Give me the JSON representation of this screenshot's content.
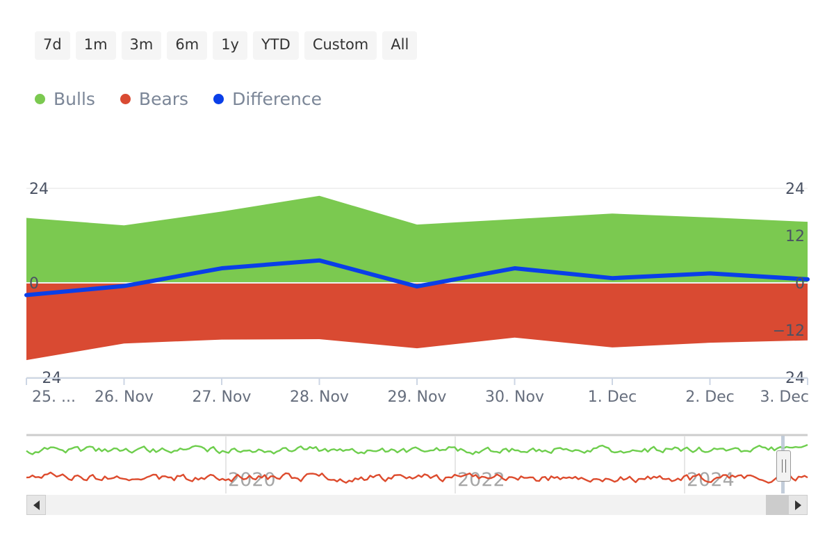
{
  "range_selector": {
    "buttons": [
      {
        "label": "7d",
        "name": "range-7d"
      },
      {
        "label": "1m",
        "name": "range-1m"
      },
      {
        "label": "3m",
        "name": "range-3m"
      },
      {
        "label": "6m",
        "name": "range-6m"
      },
      {
        "label": "1y",
        "name": "range-1y"
      },
      {
        "label": "YTD",
        "name": "range-ytd"
      },
      {
        "label": "Custom",
        "name": "range-custom"
      },
      {
        "label": "All",
        "name": "range-all"
      }
    ]
  },
  "legend": {
    "items": [
      {
        "label": "Bulls",
        "color": "#7BC950"
      },
      {
        "label": "Bears",
        "color": "#D94A32"
      },
      {
        "label": "Difference",
        "color": "#0A3FE8"
      }
    ]
  },
  "colors": {
    "bulls": "#7BC950",
    "bears": "#D94A32",
    "difference": "#0A3FE8",
    "grid": "#f0f0f0",
    "axis_line": "#cdd6e4",
    "tick": "#cdd6e4",
    "label": "#4a5263",
    "xlabel": "#666e7d",
    "legend_text": "#7b8697",
    "nav_year": "#a6a6a6",
    "nav_green": "#6ece4d",
    "nav_red": "#dd4b2d",
    "scrollbar_track": "#f2f2f2",
    "scrollbar_thumb": "#cccccc",
    "scrollbar_button": "#e6e6e6",
    "button_bg": "#f5f5f5"
  },
  "chart_data": {
    "type": "area",
    "title": "",
    "subtitle": "",
    "xlabel": "",
    "ylabel": "",
    "grid": true,
    "legend_position": "top-left",
    "ylim": [
      -24,
      24
    ],
    "y_ticks_left": [
      "24",
      "0",
      "-24"
    ],
    "y_ticks_right": [
      "24",
      "12",
      "0",
      "-12",
      "-24"
    ],
    "y_tick_values": [
      24,
      12,
      0,
      -12,
      -24
    ],
    "categories": [
      "25. ...",
      "26. Nov",
      "27. Nov",
      "28. Nov",
      "29. Nov",
      "30. Nov",
      "1. Dec",
      "2. Dec",
      "3. Dec"
    ],
    "x_tick_labels": [
      "25. ...",
      "26. Nov",
      "27. Nov",
      "28. Nov",
      "29. Nov",
      "30. Nov",
      "1. Dec",
      "2. Dec",
      "3. Dec"
    ],
    "series": [
      {
        "name": "Bulls",
        "type": "area",
        "color": "#7BC950",
        "values": [
          16.5,
          14.6,
          18.1,
          22.1,
          14.8,
          16.2,
          17.6,
          16.6,
          15.5
        ]
      },
      {
        "name": "Bears",
        "type": "area",
        "color": "#D94A32",
        "values": [
          -19.6,
          -15.4,
          -14.4,
          -14.3,
          -16.6,
          -13.9,
          -16.4,
          -15.2,
          -14.6
        ]
      },
      {
        "name": "Difference",
        "type": "line",
        "color": "#0A3FE8",
        "values": [
          -3.1,
          -0.8,
          3.7,
          5.7,
          -0.9,
          3.7,
          1.2,
          2.4,
          0.9
        ]
      }
    ]
  },
  "navigator": {
    "year_labels": [
      "2020",
      "2022",
      "2024"
    ],
    "series": [
      {
        "name": "Bulls",
        "color": "#6ece4d"
      },
      {
        "name": "Bears",
        "color": "#dd4b2d"
      }
    ],
    "handle_label": "navigator-right-handle"
  },
  "scrollbar": {
    "left_arrow": "◀",
    "right_arrow": "▶"
  }
}
